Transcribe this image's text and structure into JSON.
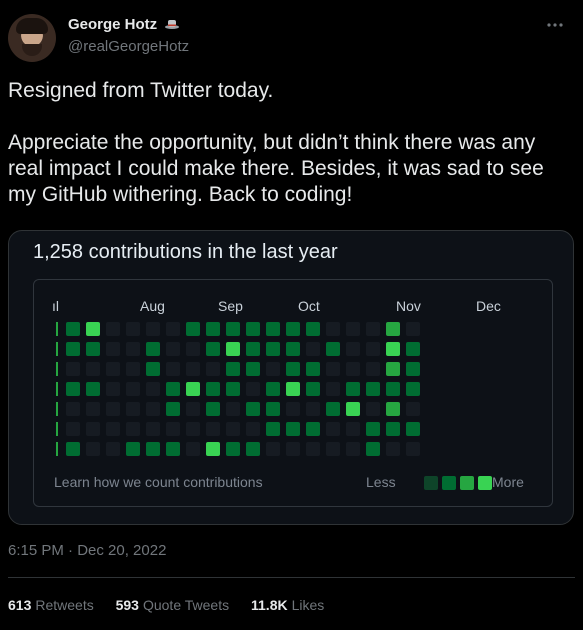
{
  "author": {
    "name": "George Hotz",
    "handle": "@realGeorgeHotz",
    "badge_icon": "hat-emoji-icon"
  },
  "tweet": {
    "lines": [
      "Resigned from Twitter today.",
      "Appreciate the opportunity, but didn’t think there was any real impact I could make there. Besides, it was sad to see my GitHub withering. Back to coding!"
    ]
  },
  "contributions": {
    "title": "1,258 contributions in the last year",
    "months": [
      "ıl",
      "Aug",
      "Sep",
      "Oct",
      "Nov",
      "Dec"
    ],
    "learn_link": "Learn how we count contributions",
    "legend_less": "Less",
    "legend_more": "More",
    "colors": [
      "#161b22",
      "#0e4429",
      "#006d32",
      "#26a641",
      "#39d353"
    ],
    "weeks": [
      [
        0,
        1,
        1,
        1,
        1,
        1,
        1
      ],
      [
        2,
        2,
        0,
        2,
        0,
        0,
        2
      ],
      [
        4,
        2,
        0,
        2,
        0,
        0,
        0
      ],
      [
        0,
        0,
        0,
        0,
        0,
        0,
        0
      ],
      [
        0,
        0,
        0,
        0,
        0,
        0,
        2
      ],
      [
        0,
        2,
        2,
        0,
        0,
        0,
        2
      ],
      [
        0,
        0,
        0,
        2,
        2,
        0,
        2
      ],
      [
        2,
        0,
        0,
        4,
        0,
        0,
        0
      ],
      [
        2,
        2,
        0,
        2,
        2,
        0,
        4
      ],
      [
        2,
        4,
        2,
        2,
        0,
        0,
        2
      ],
      [
        2,
        2,
        2,
        0,
        2,
        0,
        2
      ],
      [
        2,
        2,
        0,
        2,
        2,
        2,
        0
      ],
      [
        2,
        2,
        2,
        4,
        0,
        2,
        0
      ],
      [
        2,
        0,
        2,
        2,
        0,
        2,
        0
      ],
      [
        0,
        2,
        0,
        0,
        2,
        0,
        0
      ],
      [
        0,
        0,
        0,
        2,
        4,
        0,
        0
      ],
      [
        0,
        0,
        0,
        2,
        0,
        2,
        2
      ],
      [
        3,
        4,
        3,
        2,
        3,
        2,
        0
      ],
      [
        0,
        2,
        2,
        2,
        0,
        2,
        0
      ]
    ]
  },
  "timestamp": "6:15 PM · Dec 20, 2022",
  "stats": [
    {
      "count": "613",
      "label": "Retweets"
    },
    {
      "count": "593",
      "label": "Quote Tweets"
    },
    {
      "count": "11.8K",
      "label": "Likes"
    }
  ]
}
